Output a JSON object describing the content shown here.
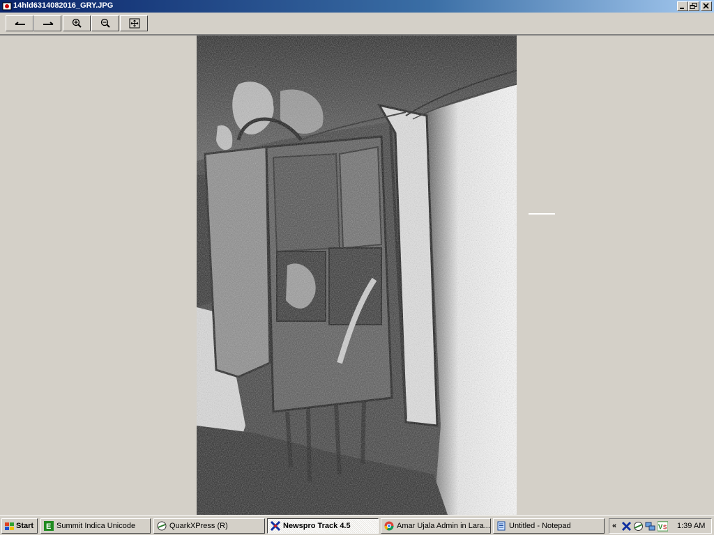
{
  "window": {
    "title": "14hld6314082016_GRY.JPG"
  },
  "toolbar": {
    "buttons": [
      "back-arrow-icon",
      "forward-arrow-icon",
      "zoom-in-icon",
      "zoom-out-icon",
      "fit-window-icon"
    ]
  },
  "taskbar": {
    "start_label": "Start",
    "tasks": [
      {
        "label": "Summit Indica Unicode",
        "icon": "summit-e-icon"
      },
      {
        "label": "QuarkXPress (R)",
        "icon": "quark-icon"
      },
      {
        "label": "Newspro Track 4.5",
        "icon": "newspro-icon",
        "active": true
      },
      {
        "label": "Amar Ujala Admin in Lara...",
        "icon": "chrome-icon"
      },
      {
        "label": "Untitled - Notepad",
        "icon": "notepad-icon"
      }
    ],
    "tray": {
      "chevron": "«",
      "clock": "1:39 AM"
    }
  },
  "colors": {
    "titlebar_start": "#0a246a",
    "titlebar_end": "#a6caf0",
    "chrome_gray": "#d4d0c8"
  }
}
